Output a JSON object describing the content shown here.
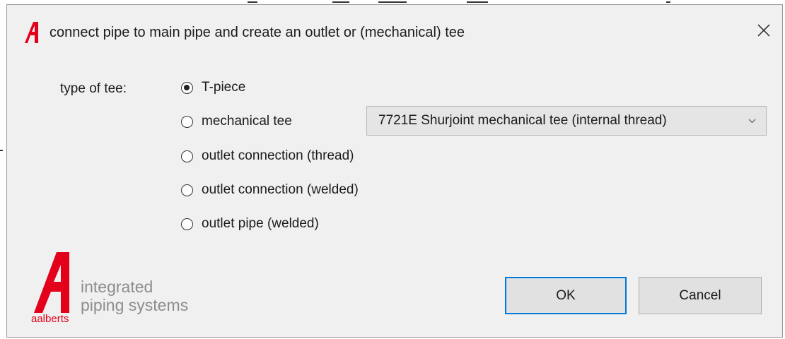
{
  "dialog": {
    "title": "connect pipe to main pipe and create an outlet or (mechanical) tee",
    "close_icon": "close-icon",
    "logo_icon": "aalberts-a-icon"
  },
  "form": {
    "group_label": "type of tee:",
    "options": [
      {
        "label": "T-piece",
        "checked": true
      },
      {
        "label": "mechanical tee",
        "checked": false
      },
      {
        "label": "outlet connection (thread)",
        "checked": false
      },
      {
        "label": "outlet connection (welded)",
        "checked": false
      },
      {
        "label": "outlet pipe (welded)",
        "checked": false
      }
    ],
    "mechanical_tee_select": {
      "value": "7721E Shurjoint mechanical tee (internal thread)"
    }
  },
  "brand": {
    "tagline_line1": "integrated",
    "tagline_line2": "piping systems",
    "name": "aalberts",
    "color": "#e2001a"
  },
  "buttons": {
    "ok_label": "OK",
    "cancel_label": "Cancel"
  },
  "colors": {
    "accent": "#0078d7",
    "dialog_bg": "#f0f0f0"
  }
}
